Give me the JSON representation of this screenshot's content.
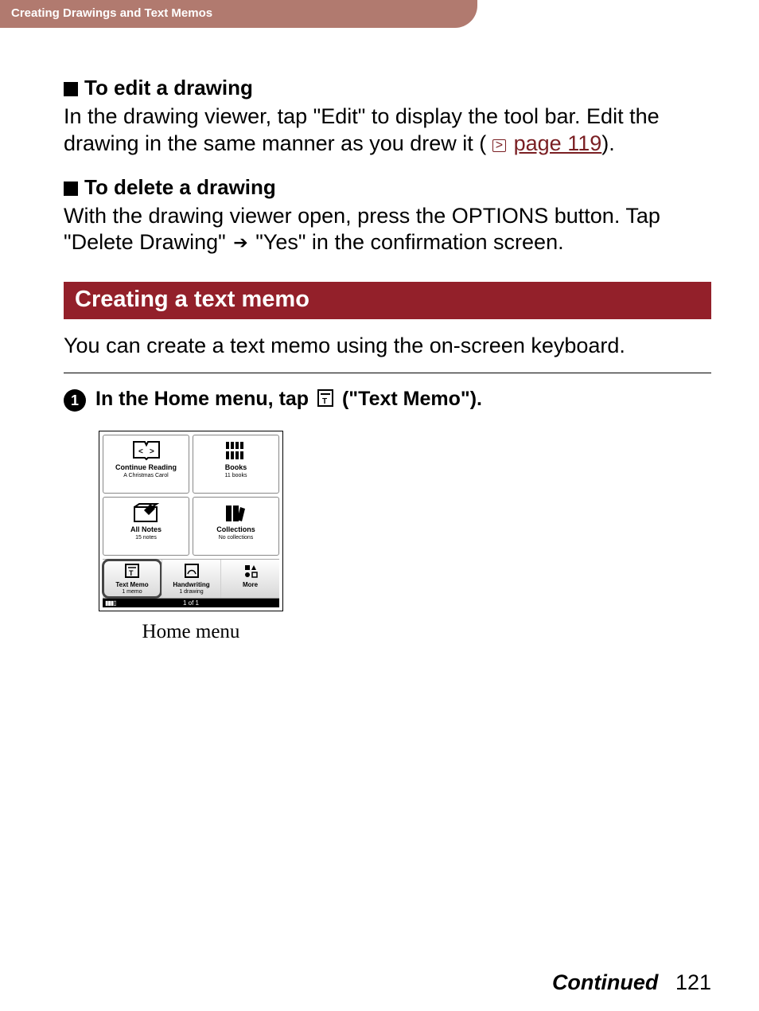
{
  "header": {
    "breadcrumb": "Creating Drawings and Text Memos"
  },
  "sections": {
    "edit": {
      "title": "To edit a drawing",
      "body_pre": "In the drawing viewer, tap \"Edit\" to display the tool bar. Edit the drawing in the same manner as you drew it (",
      "link": "page 119",
      "body_post": ")."
    },
    "delete": {
      "title": "To delete a drawing",
      "body_pre": "With the drawing viewer open, press the OPTIONS button. Tap \"Delete Drawing\" ",
      "body_post": " \"Yes\" in the confirmation screen."
    },
    "textmemo": {
      "bar": "Creating a text memo",
      "intro": "You can create a text memo using the on-screen keyboard.",
      "step1_pre": "In the Home menu, tap ",
      "step1_post": " (\"Text Memo\")."
    }
  },
  "home_menu": {
    "cells": [
      {
        "label": "Continue Reading",
        "sub": "A Christmas Carol"
      },
      {
        "label": "Books",
        "sub": "11 books"
      },
      {
        "label": "All Notes",
        "sub": "15 notes"
      },
      {
        "label": "Collections",
        "sub": "No collections"
      }
    ],
    "bottom": [
      {
        "label": "Text Memo",
        "sub": "1 memo"
      },
      {
        "label": "Handwriting",
        "sub": "1 drawing"
      },
      {
        "label": "More",
        "sub": ""
      }
    ],
    "status": "1 of 1",
    "caption": "Home menu"
  },
  "footer": {
    "continued": "Continued",
    "page": "121"
  },
  "step_number": "1"
}
